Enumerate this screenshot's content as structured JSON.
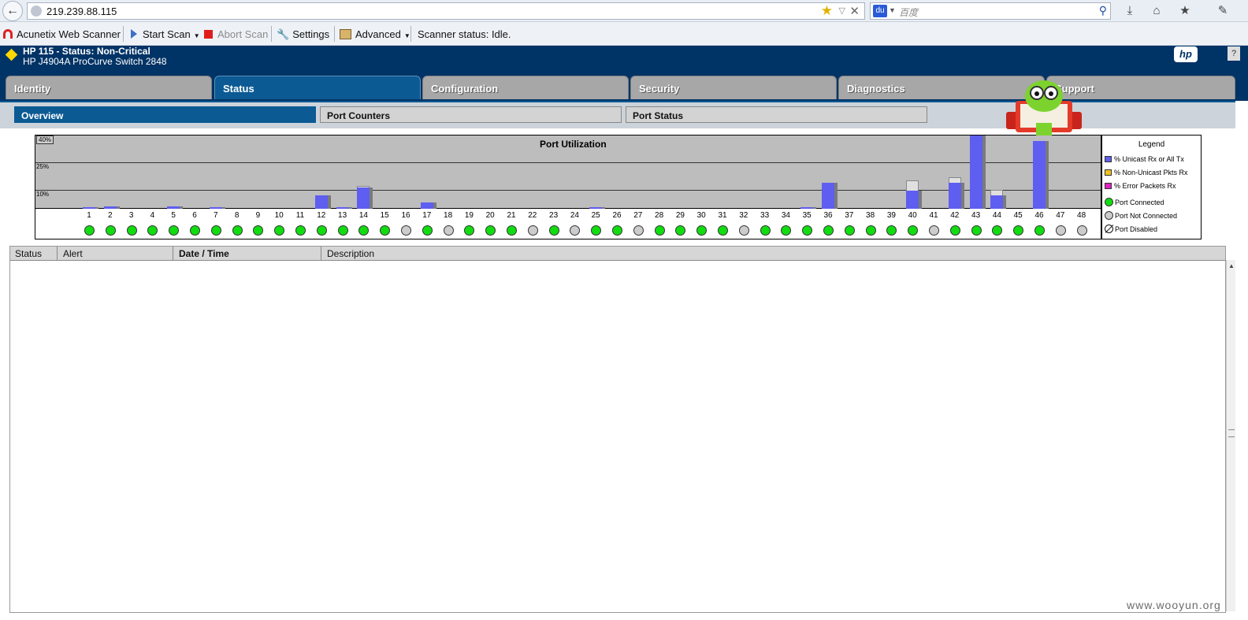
{
  "browser": {
    "url": "219.239.88.115",
    "search_placeholder": "百度",
    "search_engine_label": "du"
  },
  "toolbar": {
    "brand": "Acunetix Web Scanner",
    "start_scan": "Start Scan",
    "abort_scan": "Abort Scan",
    "settings": "Settings",
    "advanced": "Advanced",
    "status": "Scanner status: Idle."
  },
  "device": {
    "title": "HP 115 - Status: Non-Critical",
    "model": "HP J4904A ProCurve Switch 2848",
    "logo": "hp",
    "help": "?"
  },
  "tabs": [
    {
      "label": "Identity"
    },
    {
      "label": "Status"
    },
    {
      "label": "Configuration"
    },
    {
      "label": "Security"
    },
    {
      "label": "Diagnostics"
    },
    {
      "label": "Support"
    }
  ],
  "active_tab": "Status",
  "subtabs": [
    {
      "label": "Overview"
    },
    {
      "label": "Port Counters"
    },
    {
      "label": "Port Status"
    }
  ],
  "active_subtab": "Overview",
  "chart_data": {
    "type": "bar",
    "title": "Port Utilization",
    "y_ticks": [
      "40%",
      "25%",
      "10%"
    ],
    "ylim": [
      0,
      40
    ],
    "x": [
      1,
      2,
      3,
      4,
      5,
      6,
      7,
      8,
      9,
      10,
      11,
      12,
      13,
      14,
      15,
      16,
      17,
      18,
      19,
      20,
      21,
      22,
      23,
      24,
      25,
      26,
      27,
      28,
      29,
      30,
      31,
      32,
      33,
      34,
      35,
      36,
      37,
      38,
      39,
      40,
      41,
      42,
      43,
      44,
      45,
      46,
      47,
      48
    ],
    "series": [
      {
        "name": "% Unicast Rx or All Tx",
        "color": "#5e5ef0",
        "values": [
          0.6,
          1.5,
          0,
          0,
          1.5,
          0,
          0.6,
          0,
          0,
          0,
          0,
          7.5,
          0.4,
          11.5,
          0,
          0,
          3.5,
          0,
          0,
          0,
          0,
          0,
          0,
          0,
          0.3,
          0,
          0,
          0,
          0,
          0,
          0,
          0,
          0,
          0,
          0.4,
          14,
          0,
          0,
          0,
          10,
          0,
          14,
          40,
          7.5,
          0,
          37,
          0,
          0
        ]
      }
    ],
    "peak_values": [
      0,
      0,
      0,
      0,
      0,
      0,
      0,
      0,
      0,
      0,
      0,
      0,
      0,
      12.5,
      0,
      0,
      0,
      0,
      0,
      0,
      0,
      0,
      0,
      0,
      0,
      0,
      0,
      0,
      0,
      0,
      0,
      0,
      0,
      0,
      0,
      0,
      0,
      0,
      0,
      15.5,
      0,
      17,
      0,
      10.5,
      0,
      0,
      0,
      0
    ],
    "port_state": [
      "on",
      "on",
      "on",
      "on",
      "on",
      "on",
      "on",
      "on",
      "on",
      "on",
      "on",
      "on",
      "on",
      "on",
      "on",
      "off",
      "on",
      "off",
      "on",
      "on",
      "on",
      "off",
      "on",
      "off",
      "on",
      "on",
      "off",
      "on",
      "on",
      "on",
      "on",
      "off",
      "on",
      "on",
      "on",
      "on",
      "on",
      "on",
      "on",
      "on",
      "off",
      "on",
      "on",
      "on",
      "on",
      "on",
      "off",
      "off"
    ],
    "legend_placement": "right"
  },
  "legend": {
    "title": "Legend",
    "unicast": "% Unicast Rx or All Tx",
    "non_unicast": "% Non-Unicast Pkts Rx",
    "error": "% Error Packets Rx",
    "connected": "Port Connected",
    "not_connected": "Port Not Connected",
    "disabled": "Port Disabled",
    "colors": {
      "unicast": "#5e5ef0",
      "non_unicast": "#f0c020",
      "error": "#e020c0",
      "connected": "#10dc10",
      "not_connected": "#cccccc"
    }
  },
  "alerts": {
    "columns": [
      "Status",
      "Alert",
      "Date / Time",
      "Description"
    ],
    "rows": []
  },
  "watermark": "www.wooyun.org"
}
